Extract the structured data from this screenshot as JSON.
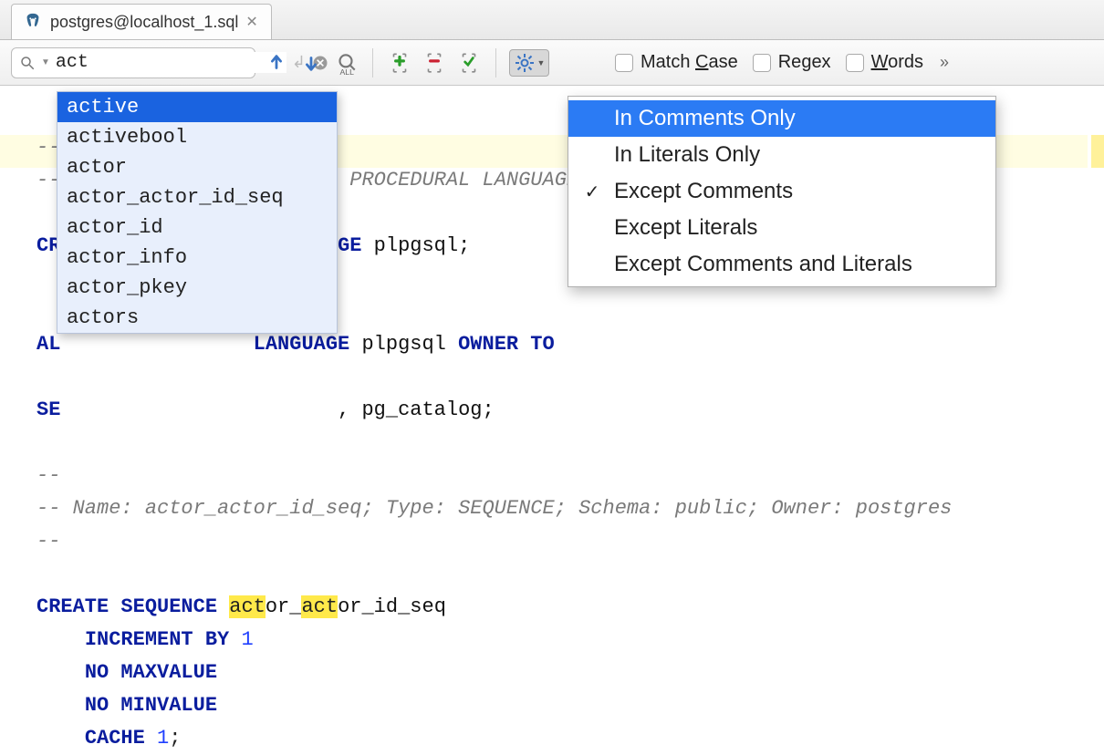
{
  "tab": {
    "title": "postgres@localhost_1.sql"
  },
  "search": {
    "value": "act"
  },
  "options": {
    "match_case": "Match Case",
    "match_case_underline_index": 6,
    "regex": "Regex",
    "regex_underline_index": 2,
    "words": "Words",
    "words_underline_index": 0
  },
  "autocomplete": [
    "active",
    "activebool",
    "actor",
    "actor_actor_id_seq",
    "actor_id",
    "actor_info",
    "actor_pkey",
    "actors"
  ],
  "settings_menu": [
    {
      "label": "In Comments Only",
      "checked": false,
      "selected": true
    },
    {
      "label": "In Literals Only",
      "checked": false,
      "selected": false
    },
    {
      "label": "Except Comments",
      "checked": true,
      "selected": false
    },
    {
      "label": "Except Literals",
      "checked": false,
      "selected": false
    },
    {
      "label": "Except Comments and Literals",
      "checked": false,
      "selected": false
    }
  ],
  "code": {
    "comment_dashes": "--",
    "comment_frag_procedural": "PROCEDURAL LANGUAGE",
    "line3_pre": "CR",
    "line3_mid": "GE",
    "line3_lang": " plpgsql;",
    "line5_pre": "AL",
    "line5_keyword": "LANGUAGE",
    "line5_lang": " plpgsql ",
    "line5_owner": "OWNER TO",
    "line6_pre": "SE",
    "line6_rest": ", pg_catalog;",
    "comment2": "-- Name: actor_actor_id_seq; Type: SEQUENCE; Schema: public; Owner: postgres",
    "create": "CREATE",
    "sequence": "SEQUENCE",
    "seq_name_pre": "act",
    "seq_name_mid1": "or_",
    "seq_name_mid2": "act",
    "seq_name_post": "or_id_seq",
    "increment_by": "INCREMENT BY",
    "one": "1",
    "no_maxvalue": "NO MAXVALUE",
    "no_minvalue": "NO MINVALUE",
    "cache": "CACHE",
    "semicolon": ";"
  }
}
